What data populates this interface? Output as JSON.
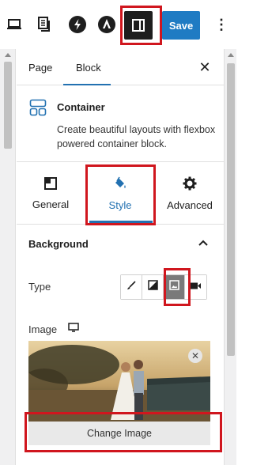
{
  "toolbar": {
    "icons": [
      "laptop-icon",
      "document-outline-icon",
      "bolt-logo-icon",
      "astra-logo-icon",
      "sidebar-toggle-icon",
      "more-vertical-icon"
    ],
    "save_label": "Save",
    "more_label": "⋮"
  },
  "sidebar": {
    "tabs": [
      {
        "label": "Page",
        "active": false
      },
      {
        "label": "Block",
        "active": true
      }
    ],
    "close_label": "✕"
  },
  "block_card": {
    "icon": "container-icon",
    "title": "Container",
    "description": "Create beautiful layouts with flexbox powered container block."
  },
  "inspector_tabs": [
    {
      "label": "General",
      "icon": "general-layout-icon",
      "active": false
    },
    {
      "label": "Style",
      "icon": "paint-bucket-icon",
      "active": true
    },
    {
      "label": "Advanced",
      "icon": "gear-icon",
      "active": false
    }
  ],
  "background": {
    "title": "Background",
    "chevron": "chevron-up-icon",
    "type_label": "Type",
    "type_options": [
      {
        "icon": "brush-icon",
        "active": false
      },
      {
        "icon": "gradient-icon",
        "active": false
      },
      {
        "icon": "image-icon",
        "active": true
      },
      {
        "icon": "video-icon",
        "active": false
      }
    ],
    "image_label": "Image",
    "device_icon": "desktop-icon",
    "remove_label": "✕",
    "change_image_label": "Change Image"
  },
  "colors": {
    "accent": "#2271b1",
    "save_button": "#1f7bc3",
    "highlight": "#d0161e"
  }
}
